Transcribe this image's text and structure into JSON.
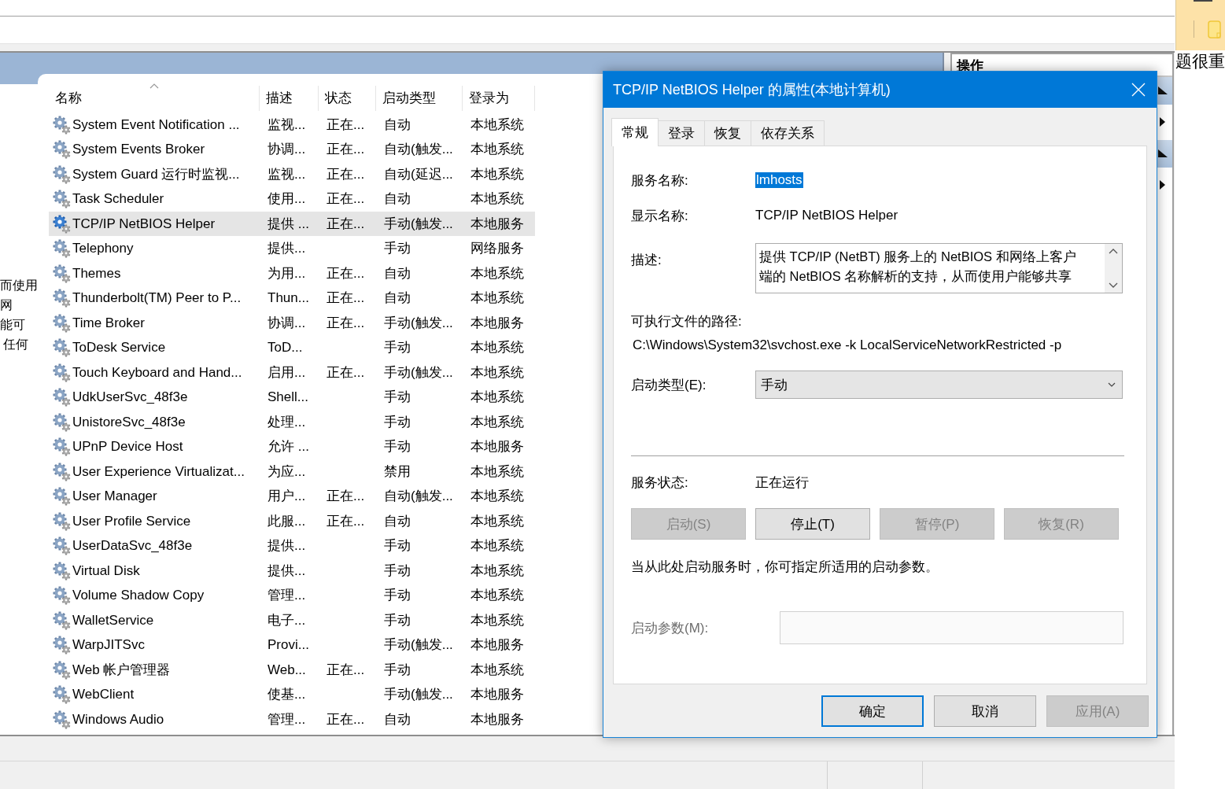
{
  "services": {
    "columns": [
      "名称",
      "描述",
      "状态",
      "启动类型",
      "登录为"
    ],
    "rows": [
      {
        "name": "System Event Notification ...",
        "description": "监视...",
        "status": "正在...",
        "startup_type": "自动",
        "log_on_as": "本地系统",
        "selected": false
      },
      {
        "name": "System Events Broker",
        "description": "协调...",
        "status": "正在...",
        "startup_type": "自动(触发...",
        "log_on_as": "本地系统",
        "selected": false
      },
      {
        "name": "System Guard 运行时监视...",
        "description": "监视...",
        "status": "正在...",
        "startup_type": "自动(延迟...",
        "log_on_as": "本地系统",
        "selected": false
      },
      {
        "name": "Task Scheduler",
        "description": "使用...",
        "status": "正在...",
        "startup_type": "自动",
        "log_on_as": "本地系统",
        "selected": false
      },
      {
        "name": "TCP/IP NetBIOS Helper",
        "description": "提供 ...",
        "status": "正在...",
        "startup_type": "手动(触发...",
        "log_on_as": "本地服务",
        "selected": true
      },
      {
        "name": "Telephony",
        "description": "提供...",
        "startup_type": "手动",
        "log_on_as": "网络服务",
        "selected": false
      },
      {
        "name": "Themes",
        "description": "为用...",
        "status": "正在...",
        "startup_type": "自动",
        "log_on_as": "本地系统",
        "selected": false
      },
      {
        "name": "Thunderbolt(TM) Peer to P...",
        "description": "Thun...",
        "status": "正在...",
        "startup_type": "自动",
        "log_on_as": "本地系统",
        "selected": false
      },
      {
        "name": "Time Broker",
        "description": "协调...",
        "status": "正在...",
        "startup_type": "手动(触发...",
        "log_on_as": "本地服务",
        "selected": false
      },
      {
        "name": "ToDesk Service",
        "description": "ToD...",
        "startup_type": "手动",
        "log_on_as": "本地系统",
        "selected": false
      },
      {
        "name": "Touch Keyboard and Hand...",
        "description": "启用...",
        "status": "正在...",
        "startup_type": "手动(触发...",
        "log_on_as": "本地系统",
        "selected": false
      },
      {
        "name": "UdkUserSvc_48f3e",
        "description": "Shell...",
        "startup_type": "手动",
        "log_on_as": "本地系统",
        "selected": false
      },
      {
        "name": "UnistoreSvc_48f3e",
        "description": "处理...",
        "startup_type": "手动",
        "log_on_as": "本地系统",
        "selected": false
      },
      {
        "name": "UPnP Device Host",
        "description": "允许 ...",
        "startup_type": "手动",
        "log_on_as": "本地服务",
        "selected": false
      },
      {
        "name": "User Experience Virtualizat...",
        "description": "为应...",
        "startup_type": "禁用",
        "log_on_as": "本地系统",
        "selected": false
      },
      {
        "name": "User Manager",
        "description": "用户...",
        "status": "正在...",
        "startup_type": "自动(触发...",
        "log_on_as": "本地系统",
        "selected": false
      },
      {
        "name": "User Profile Service",
        "description": "此服...",
        "status": "正在...",
        "startup_type": "自动",
        "log_on_as": "本地系统",
        "selected": false
      },
      {
        "name": "UserDataSvc_48f3e",
        "description": "提供...",
        "startup_type": "手动",
        "log_on_as": "本地系统",
        "selected": false
      },
      {
        "name": "Virtual Disk",
        "description": "提供...",
        "startup_type": "手动",
        "log_on_as": "本地系统",
        "selected": false
      },
      {
        "name": "Volume Shadow Copy",
        "description": "管理...",
        "startup_type": "手动",
        "log_on_as": "本地系统",
        "selected": false
      },
      {
        "name": "WalletService",
        "description": "电子...",
        "startup_type": "手动",
        "log_on_as": "本地系统",
        "selected": false
      },
      {
        "name": "WarpJITSvc",
        "description": "Provi...",
        "startup_type": "手动(触发...",
        "log_on_as": "本地服务",
        "selected": false
      },
      {
        "name": "Web 帐户管理器",
        "description": "Web...",
        "status": "正在...",
        "startup_type": "手动",
        "log_on_as": "本地系统",
        "selected": false
      },
      {
        "name": "WebClient",
        "description": "使基...",
        "startup_type": "手动(触发...",
        "log_on_as": "本地服务",
        "selected": false
      },
      {
        "name": "Windows Audio",
        "description": "管理...",
        "status": "正在...",
        "startup_type": "自动",
        "log_on_as": "本地服务",
        "selected": false
      }
    ]
  },
  "actions_panel": {
    "title": "操作"
  },
  "side_text": {
    "left_lines": [
      "而使用",
      "网",
      "能可",
      "任何"
    ],
    "right": "题很重"
  },
  "dialog": {
    "title": "TCP/IP NetBIOS Helper 的属性(本地计算机)",
    "tabs": [
      {
        "label": "常规",
        "selected": true
      },
      {
        "label": "登录",
        "selected": false
      },
      {
        "label": "恢复",
        "selected": false
      },
      {
        "label": "依存关系",
        "selected": false
      }
    ],
    "service_name": {
      "label": "服务名称:",
      "value": "lmhosts",
      "highlighted": true
    },
    "display_name": {
      "label": "显示名称:",
      "value": "TCP/IP NetBIOS Helper"
    },
    "description": {
      "label": "描述:",
      "lines": [
        "提供 TCP/IP (NetBT) 服务上的 NetBIOS 和网络上客户",
        "端的 NetBIOS 名称解析的支持，从而使用户能够共享"
      ]
    },
    "path": {
      "label": "可执行文件的路径:",
      "value": "C:\\Windows\\System32\\svchost.exe -k LocalServiceNetworkRestricted -p"
    },
    "startup_type": {
      "label": "启动类型(E):",
      "value": "手动"
    },
    "service_status": {
      "label": "服务状态:",
      "value": "正在运行"
    },
    "control_buttons": [
      {
        "label": "启动(S)",
        "disabled": true
      },
      {
        "label": "停止(T)",
        "disabled": false
      },
      {
        "label": "暂停(P)",
        "disabled": true
      },
      {
        "label": "恢复(R)",
        "disabled": true
      }
    ],
    "note": "当从此处启动服务时，你可指定所适用的启动参数。",
    "start_params": {
      "label": "启动参数(M):",
      "disabled": true
    },
    "footer_buttons": [
      {
        "label": "确定",
        "disabled": false,
        "default": true
      },
      {
        "label": "取消",
        "disabled": false,
        "default": false
      },
      {
        "label": "应用(A)",
        "disabled": true,
        "default": false
      }
    ]
  }
}
